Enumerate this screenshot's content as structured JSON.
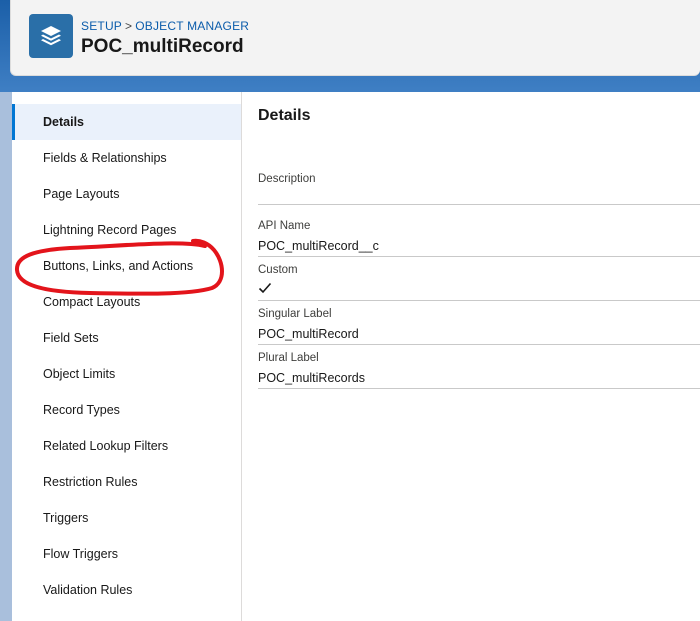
{
  "header": {
    "breadcrumb": [
      "SETUP",
      "OBJECT MANAGER"
    ],
    "breadcrumb_separator": ">",
    "title": "POC_multiRecord",
    "icon": "layers-icon"
  },
  "sidebar": {
    "items": [
      {
        "label": "Details",
        "active": true
      },
      {
        "label": "Fields & Relationships"
      },
      {
        "label": "Page Layouts"
      },
      {
        "label": "Lightning Record Pages"
      },
      {
        "label": "Buttons, Links, and Actions"
      },
      {
        "label": "Compact Layouts"
      },
      {
        "label": "Field Sets"
      },
      {
        "label": "Object Limits"
      },
      {
        "label": "Record Types"
      },
      {
        "label": "Related Lookup Filters"
      },
      {
        "label": "Restriction Rules"
      },
      {
        "label": "Triggers"
      },
      {
        "label": "Flow Triggers"
      },
      {
        "label": "Validation Rules"
      }
    ]
  },
  "details": {
    "title": "Details",
    "fields": {
      "description": {
        "label": "Description",
        "value": ""
      },
      "api_name": {
        "label": "API Name",
        "value": "POC_multiRecord__c"
      },
      "custom": {
        "label": "Custom",
        "value": "checked"
      },
      "singular_label": {
        "label": "Singular Label",
        "value": "POC_multiRecord"
      },
      "plural_label": {
        "label": "Plural Label",
        "value": "POC_multiRecords"
      }
    }
  },
  "colors": {
    "accent": "#0176d3",
    "annotation": "#e3141b",
    "header_icon_bg": "#2a6fa8"
  }
}
